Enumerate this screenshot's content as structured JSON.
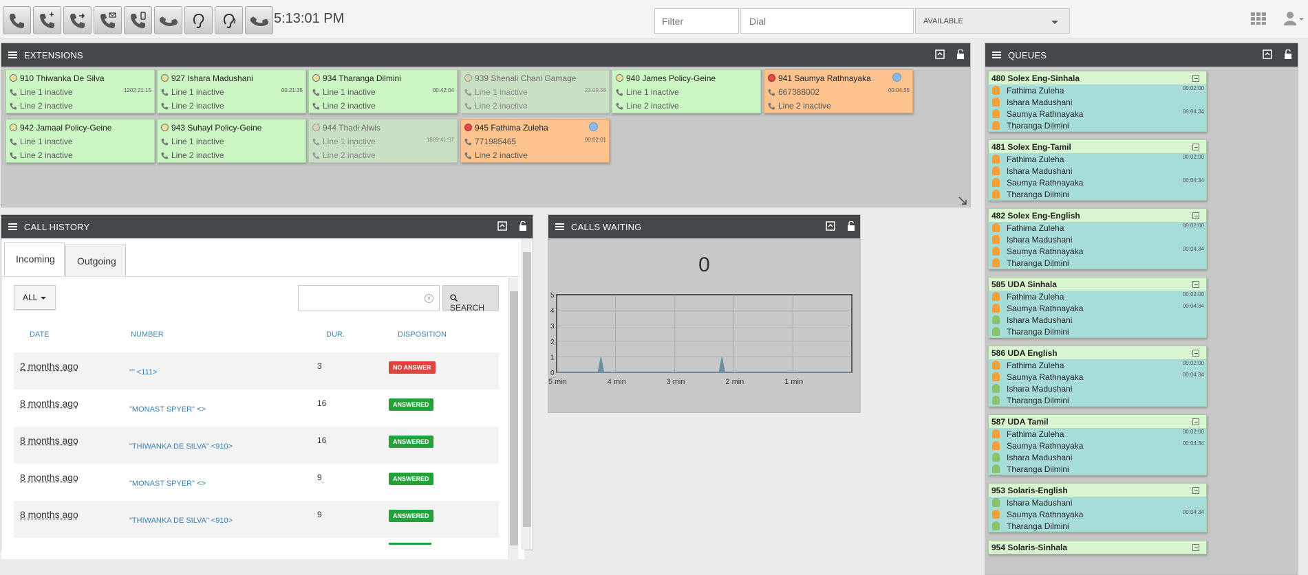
{
  "toolbar": {
    "clock": "5:13:01 PM",
    "filter_placeholder": "Filter",
    "dial_placeholder": "Dial",
    "status": "AVAILABLE",
    "buttons": [
      "phone-icon",
      "phone-add-icon",
      "phone-transfer-icon",
      "phone-mail-icon",
      "phone-mobile-icon",
      "phone-hangup-icon",
      "ear-icon",
      "listen-icon",
      "phone-hold-icon"
    ]
  },
  "extensions": {
    "title": "EXTENSIONS",
    "items": [
      {
        "name": "910 Thiwanka De Silva",
        "line1": "Line 1 inactive",
        "line2": "Line 2 inactive",
        "dur": "1202:21:15",
        "state": "idle"
      },
      {
        "name": "927 Ishara Madushani",
        "line1": "Line 1 inactive",
        "line2": "Line 2 inactive",
        "dur": "00:21:35",
        "state": "idle"
      },
      {
        "name": "934 Tharanga Dilmini",
        "line1": "Line 1 inactive",
        "line2": "Line 2 inactive",
        "dur": "00:42:04",
        "state": "idle"
      },
      {
        "name": "939 Shenali Chani Gamage",
        "line1": "Line 1 inactive",
        "line2": "Line 2 inactive",
        "dur": "23:09:59",
        "state": "dim"
      },
      {
        "name": "940 James Policy-Geine",
        "line1": "Line 1 inactive",
        "line2": "Line 2 inactive",
        "dur": "",
        "state": "idle"
      },
      {
        "name": "941 Saumya Rathnayaka",
        "line1": "667388002",
        "line2": "Line 2 inactive",
        "dur": "00:04:35",
        "state": "busy"
      },
      {
        "name": "942 Jamaal Policy-Geine",
        "line1": "Line 1 inactive",
        "line2": "Line 2 inactive",
        "dur": "",
        "state": "idle"
      },
      {
        "name": "943 Suhayl Policy-Geine",
        "line1": "Line 1 inactive",
        "line2": "Line 2 inactive",
        "dur": "",
        "state": "idle"
      },
      {
        "name": "944 Thadi Alwis",
        "line1": "Line 1 inactive",
        "line2": "Line 2 inactive",
        "dur": "1889:41:57",
        "state": "dim"
      },
      {
        "name": "945 Fathima Zuleha",
        "line1": "771985465",
        "line2": "Line 2 inactive",
        "dur": "00:02:01",
        "state": "busy"
      }
    ]
  },
  "call_history": {
    "title": "CALL HISTORY",
    "tabs": [
      "Incoming",
      "Outgoing"
    ],
    "filter": "ALL",
    "search_label": "SEARCH",
    "columns": [
      "DATE",
      "NUMBER",
      "DUR.",
      "DISPOSITION"
    ],
    "rows": [
      {
        "date": "2 months ago",
        "number": "\"\" <111>",
        "dur": "3",
        "disposition": "NO ANSWER"
      },
      {
        "date": "8 months ago",
        "number": "\"MONAST SPYER\" <>",
        "dur": "16",
        "disposition": "ANSWERED"
      },
      {
        "date": "8 months ago",
        "number": "\"THIWANKA DE SILVA\" <910>",
        "dur": "16",
        "disposition": "ANSWERED"
      },
      {
        "date": "8 months ago",
        "number": "\"MONAST SPYER\" <>",
        "dur": "9",
        "disposition": "ANSWERED"
      },
      {
        "date": "8 months ago",
        "number": "\"THIWANKA DE SILVA\" <910>",
        "dur": "9",
        "disposition": "ANSWERED"
      }
    ]
  },
  "calls_waiting": {
    "title": "CALLS WAITING",
    "count": "0"
  },
  "chart_data": {
    "type": "area",
    "x_ticks": [
      "5 min",
      "4 min",
      "3 min",
      "2 min",
      "1 min"
    ],
    "y_ticks": [
      "5",
      "4",
      "3",
      "2",
      "1",
      "0"
    ],
    "ylim": [
      0,
      5
    ],
    "xlim": [
      5,
      0
    ],
    "x": [
      5,
      4.3,
      4.25,
      4.2,
      2.25,
      2.2,
      2.15,
      0
    ],
    "values": [
      0,
      0,
      1,
      0,
      0,
      1,
      0,
      0
    ],
    "color": "#6d8fa0",
    "grid": true
  },
  "queues": {
    "title": "QUEUES",
    "items": [
      {
        "name": "480 Solex Eng-Sinhala",
        "members": [
          {
            "n": "Fathima Zuleha",
            "t": "00:02:00",
            "c": "o"
          },
          {
            "n": "Ishara Madushani",
            "t": "",
            "c": "o"
          },
          {
            "n": "Saumya Rathnayaka",
            "t": "00:04:34",
            "c": "o"
          },
          {
            "n": "Tharanga Dilmini",
            "t": "",
            "c": "o"
          }
        ]
      },
      {
        "name": "481 Solex Eng-Tamil",
        "members": [
          {
            "n": "Fathima Zuleha",
            "t": "00:02:00",
            "c": "o"
          },
          {
            "n": "Ishara Madushani",
            "t": "",
            "c": "o"
          },
          {
            "n": "Saumya Rathnayaka",
            "t": "00:04:34",
            "c": "o"
          },
          {
            "n": "Tharanga Dilmini",
            "t": "",
            "c": "o"
          }
        ]
      },
      {
        "name": "482 Solex Eng-English",
        "members": [
          {
            "n": "Fathima Zuleha",
            "t": "00:02:00",
            "c": "o"
          },
          {
            "n": "Ishara Madushani",
            "t": "",
            "c": "o"
          },
          {
            "n": "Saumya Rathnayaka",
            "t": "00:04:34",
            "c": "o"
          },
          {
            "n": "Tharanga Dilmini",
            "t": "",
            "c": "o"
          }
        ]
      },
      {
        "name": "585 UDA Sinhala",
        "members": [
          {
            "n": "Fathima Zuleha",
            "t": "00:02:00",
            "c": "o"
          },
          {
            "n": "Saumya Rathnayaka",
            "t": "00:04:34",
            "c": "o"
          },
          {
            "n": "Ishara Madushani",
            "t": "",
            "c": "g"
          },
          {
            "n": "Tharanga Dilmini",
            "t": "",
            "c": "g"
          }
        ]
      },
      {
        "name": "586 UDA English",
        "members": [
          {
            "n": "Fathima Zuleha",
            "t": "00:02:00",
            "c": "o"
          },
          {
            "n": "Saumya Rathnayaka",
            "t": "00:04:34",
            "c": "o"
          },
          {
            "n": "Ishara Madushani",
            "t": "",
            "c": "g"
          },
          {
            "n": "Tharanga Dilmini",
            "t": "",
            "c": "g"
          }
        ]
      },
      {
        "name": "587 UDA Tamil",
        "members": [
          {
            "n": "Fathima Zuleha",
            "t": "00:02:00",
            "c": "o"
          },
          {
            "n": "Saumya Rathnayaka",
            "t": "00:04:34",
            "c": "o"
          },
          {
            "n": "Ishara Madushani",
            "t": "",
            "c": "g"
          },
          {
            "n": "Tharanga Dilmini",
            "t": "",
            "c": "g"
          }
        ]
      },
      {
        "name": "953 Solaris-English",
        "members": [
          {
            "n": "Ishara Madushani",
            "t": "",
            "c": "g"
          },
          {
            "n": "Saumya Rathnayaka",
            "t": "00:04:34",
            "c": "o"
          },
          {
            "n": "Tharanga Dilmini",
            "t": "",
            "c": "g"
          }
        ]
      },
      {
        "name": "954 Solaris-Sinhala",
        "members": []
      }
    ]
  }
}
